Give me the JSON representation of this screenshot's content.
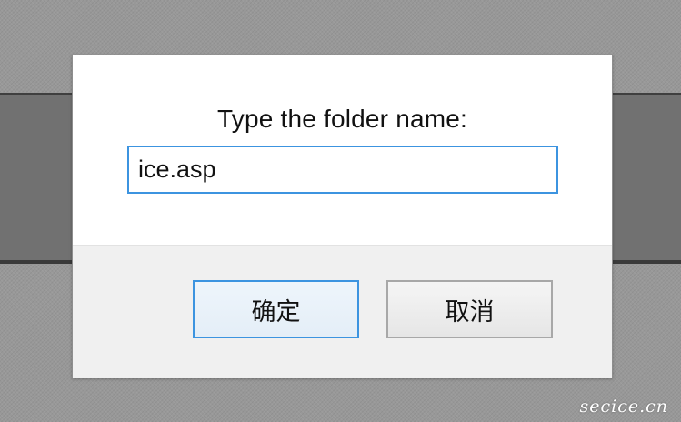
{
  "dialog": {
    "prompt": "Type the folder name:",
    "input_value": "ice.asp",
    "buttons": {
      "ok_label": "确定",
      "cancel_label": "取消"
    }
  },
  "watermark": "secice.cn",
  "colors": {
    "accent": "#3c94e0",
    "backdrop": "#989898",
    "band": "#717171",
    "dialog_bg": "#ffffff",
    "footer_bg": "#f0f0f0"
  }
}
